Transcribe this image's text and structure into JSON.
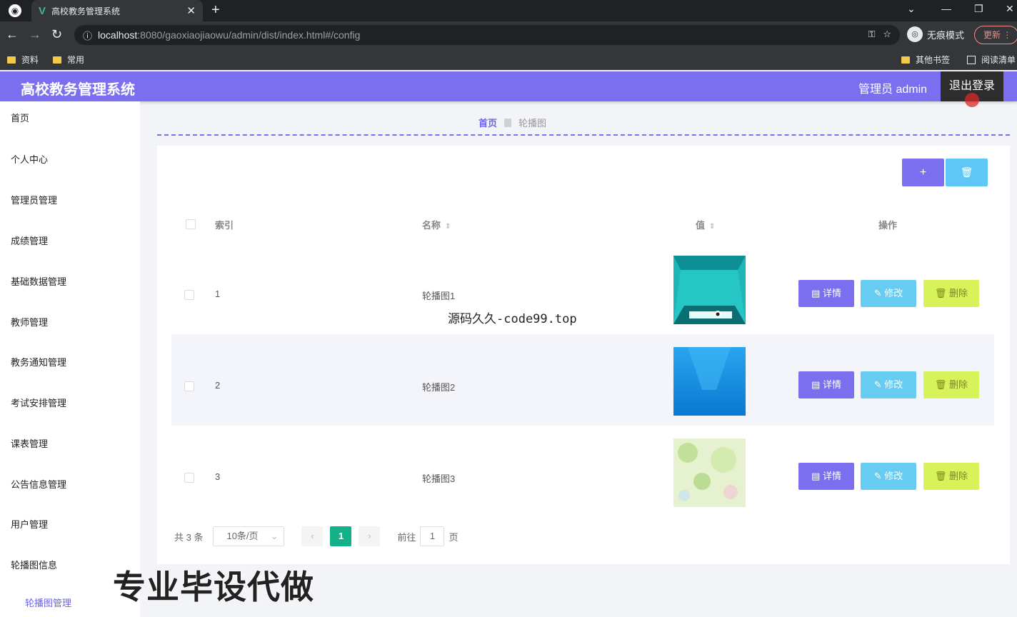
{
  "browser": {
    "tab_title": "高校教务管理系统",
    "url_host": "localhost",
    "url_path": ":8080/gaoxiaojiaowu/admin/dist/index.html#/config",
    "incognito_label": "无痕模式",
    "update_label": "更新",
    "bookmarks": [
      "资料",
      "常用"
    ],
    "bookmarks_right": [
      "其他书签",
      "阅读清单"
    ]
  },
  "header": {
    "title": "高校教务管理系统",
    "admin_label": "管理员 admin",
    "logout_label": "退出登录"
  },
  "sidebar": {
    "items": [
      "首页",
      "个人中心",
      "管理员管理",
      "成绩管理",
      "基础数据管理",
      "教师管理",
      "教务通知管理",
      "考试安排管理",
      "课表管理",
      "公告信息管理",
      "用户管理",
      "轮播图信息"
    ],
    "sub_item": "轮播图管理"
  },
  "breadcrumb": {
    "home": "首页",
    "current": "轮播图"
  },
  "toolbar": {
    "add_icon": "+",
    "delete_icon": "🗑"
  },
  "table": {
    "headers": {
      "index": "索引",
      "name": "名称",
      "value": "值",
      "actions": "操作"
    },
    "rows": [
      {
        "index": "1",
        "name": "轮播图1",
        "thumb": "teal-room"
      },
      {
        "index": "2",
        "name": "轮播图2",
        "thumb": "blue-gradient"
      },
      {
        "index": "3",
        "name": "轮播图3",
        "thumb": "green-bokeh"
      }
    ],
    "actions": {
      "detail": "详情",
      "edit": "修改",
      "delete": "删除"
    }
  },
  "pagination": {
    "total": "共 3 条",
    "page_size": "10条/页",
    "current_page": "1",
    "goto_label": "前往",
    "goto_value": "1",
    "page_suffix": "页"
  },
  "overlays": {
    "caption": "源码久久-code99.top",
    "banner": "专业毕设代做"
  },
  "colors": {
    "primary": "#7b6ff0",
    "edit": "#66ccf2",
    "delete": "#d8f25a",
    "page_active": "#13b18a"
  }
}
